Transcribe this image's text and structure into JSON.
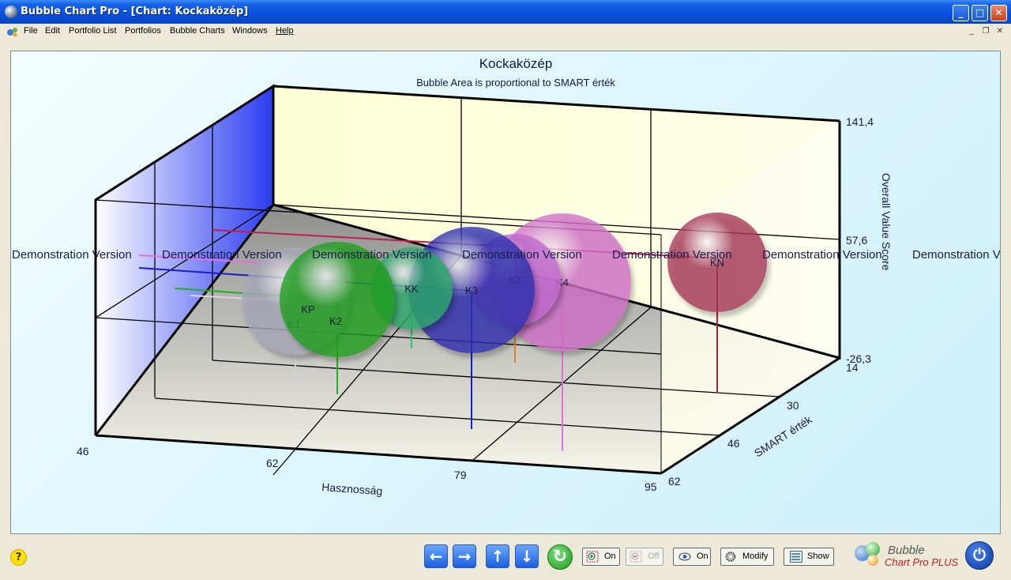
{
  "window": {
    "title": "Bubble Chart Pro - [Chart: Kockaközép]"
  },
  "menu": [
    "File",
    "Edit",
    "Portfolio List",
    "Portfolios",
    "Bubble Charts",
    "Windows",
    "Help"
  ],
  "chart_data": {
    "type": "scatter",
    "title": "Kockaközép",
    "subtitle": "Bubble Area is proportional to SMART érték",
    "xlabel": "Hasznosság",
    "ylabel": "Overall Value Score",
    "zlabel": "SMART érték",
    "x_ticks": [
      "46",
      "62",
      "79",
      "95"
    ],
    "y_ticks": [
      "141,4",
      "57,6",
      "-26,3"
    ],
    "z_ticks": [
      "14",
      "30",
      "46",
      "62"
    ],
    "watermark": "Demonstration Version",
    "bubbles": [
      {
        "name": "KN",
        "color": "#a83a5a"
      },
      {
        "name": "K4",
        "color": "#d070c8"
      },
      {
        "name": "KZ",
        "color": "#c26ad0"
      },
      {
        "name": "K3",
        "color": "#2f2fb0"
      },
      {
        "name": "KK",
        "color": "#2eaa6a"
      },
      {
        "name": "K2",
        "color": "#20a020"
      },
      {
        "name": "KP",
        "color": "#28a028"
      },
      {
        "name": "K1",
        "color": "#a8a8b8"
      }
    ]
  },
  "toolbar": {
    "help": "?",
    "zoom_in_label": "On",
    "zoom_out_label": "Off",
    "view_label": "On",
    "modify_label": "Modify",
    "show_label": "Show",
    "logo_line1": "Bubble",
    "logo_line2": "Chart Pro PLUS"
  }
}
